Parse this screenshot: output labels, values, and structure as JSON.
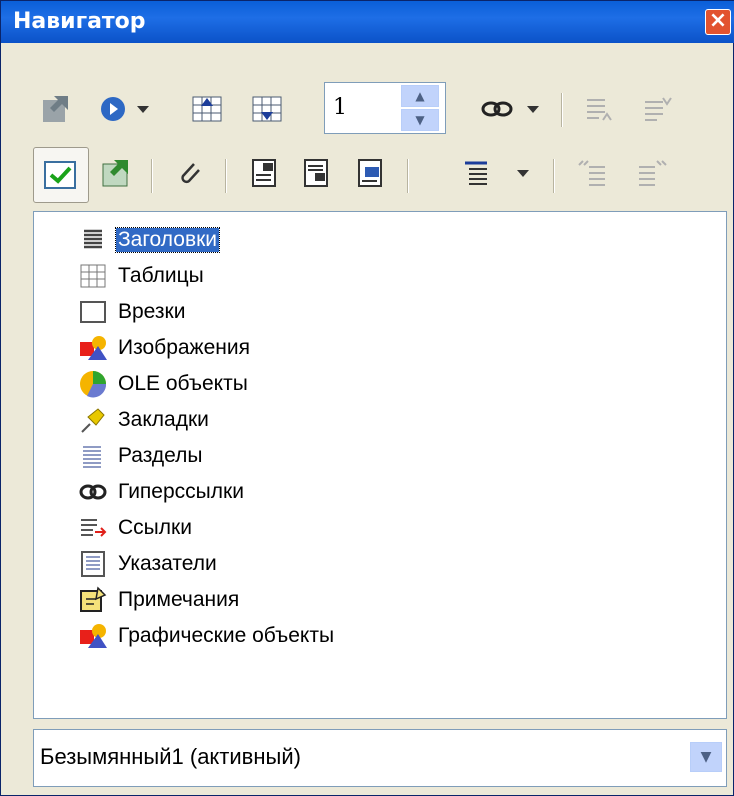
{
  "window": {
    "title": "Навигатор"
  },
  "toolbar": {
    "page_number": "1"
  },
  "tree": {
    "items": [
      {
        "label": "Заголовки",
        "icon": "headings-icon",
        "selected": true
      },
      {
        "label": "Таблицы",
        "icon": "table-icon"
      },
      {
        "label": "Врезки",
        "icon": "frame-icon"
      },
      {
        "label": "Изображения",
        "icon": "images-icon"
      },
      {
        "label": "OLE объекты",
        "icon": "ole-object-icon"
      },
      {
        "label": "Закладки",
        "icon": "bookmark-pin-icon"
      },
      {
        "label": "Разделы",
        "icon": "sections-icon"
      },
      {
        "label": "Гиперссылки",
        "icon": "hyperlink-icon"
      },
      {
        "label": "Ссылки",
        "icon": "references-icon"
      },
      {
        "label": "Указатели",
        "icon": "indexes-icon"
      },
      {
        "label": "Примечания",
        "icon": "notes-icon"
      },
      {
        "label": "Графические объекты",
        "icon": "drawing-objects-icon"
      }
    ]
  },
  "document_select": {
    "value": "Безымянный1 (активный)"
  },
  "colors": {
    "title_bar": "#0a5fd8",
    "selection": "#316ac5",
    "face": "#ece9d8"
  }
}
